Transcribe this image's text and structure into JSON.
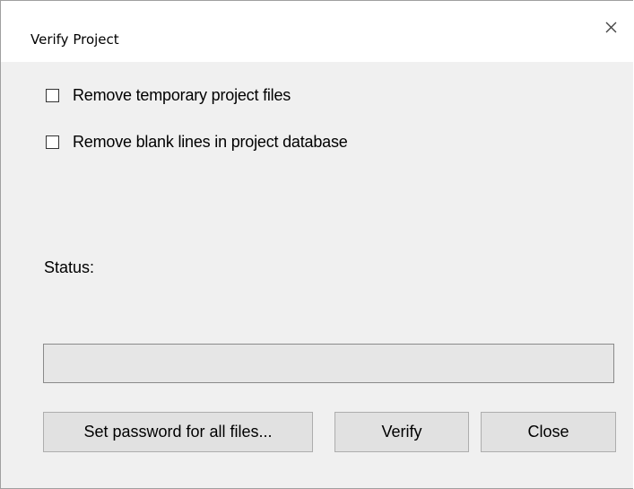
{
  "window": {
    "title": "Verify Project",
    "close_glyph": "close-icon"
  },
  "options": [
    {
      "label": "Remove temporary project files",
      "checked": false
    },
    {
      "label": "Remove blank lines in project database",
      "checked": false
    }
  ],
  "status": {
    "label": "Status:",
    "progress": 0
  },
  "buttons": {
    "set_password": "Set password for all files...",
    "verify": "Verify",
    "close": "Close"
  }
}
